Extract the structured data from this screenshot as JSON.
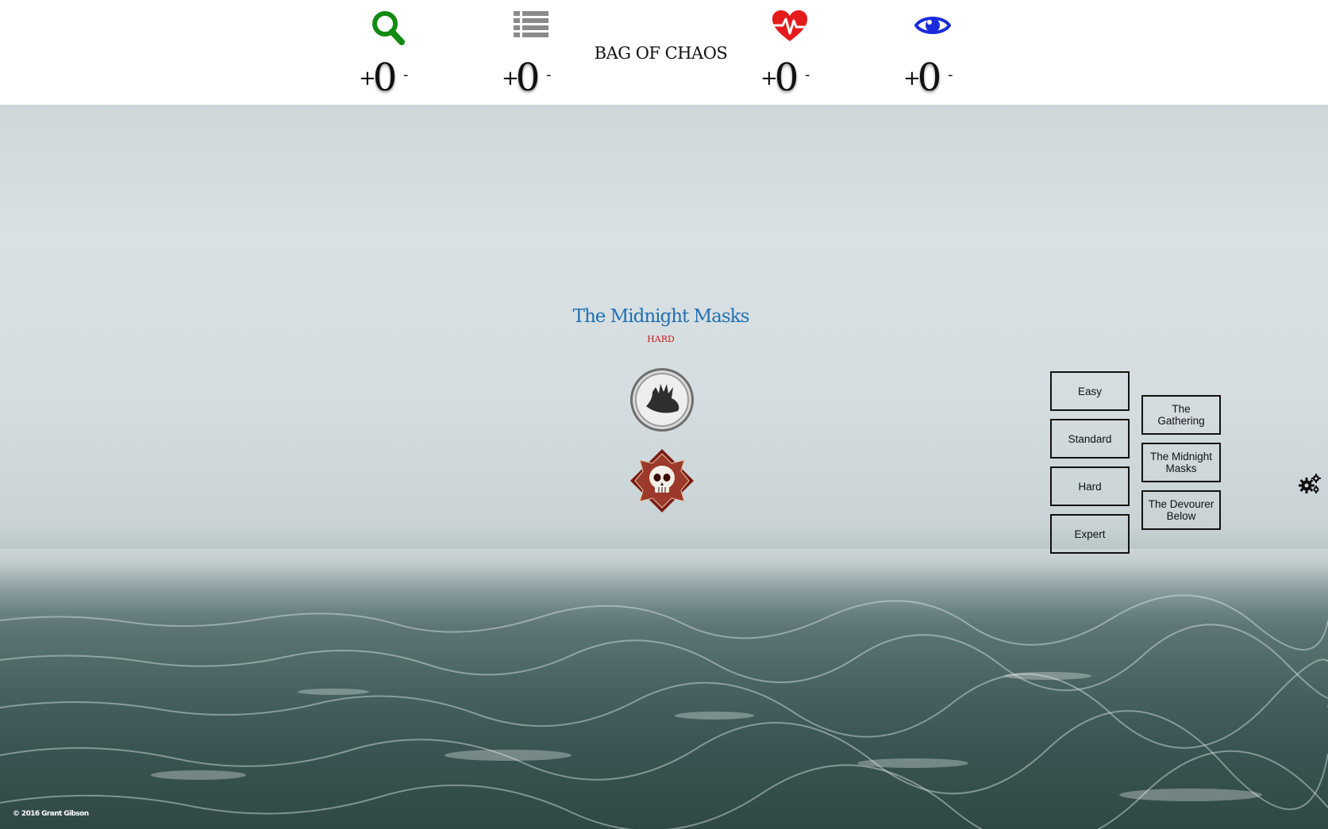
{
  "header": {
    "title": "BAG OF CHAOS",
    "stats": [
      {
        "icon": "search-icon",
        "color": "#138a13",
        "plus": "+",
        "value": "0",
        "minus": "-"
      },
      {
        "icon": "list-icon",
        "color": "#8a8a8a",
        "plus": "+",
        "value": "0",
        "minus": "-"
      },
      {
        "icon": "heart-pulse-icon",
        "color": "#e51b1b",
        "plus": "+",
        "value": "0",
        "minus": "-"
      },
      {
        "icon": "eye-icon",
        "color": "#1a2bdc",
        "plus": "+",
        "value": "0",
        "minus": "-"
      }
    ]
  },
  "scenario": {
    "title": "The Midnight Masks",
    "difficulty": "HARD",
    "tokens": [
      "elder-sign-hand-token-icon",
      "skull-token-icon"
    ]
  },
  "difficulty_buttons": [
    "Easy",
    "Standard",
    "Hard",
    "Expert"
  ],
  "scenario_buttons": [
    "The Gathering",
    "The Midnight Masks",
    "The Devourer Below"
  ],
  "settings": {
    "icon": "gears-icon"
  },
  "footer": {
    "copyright": "© 2016 Grant Gibson"
  },
  "colors": {
    "title_blue": "#1f6fb3",
    "difficulty_red": "#c81e1e",
    "skull_token": "#7a1c14"
  }
}
